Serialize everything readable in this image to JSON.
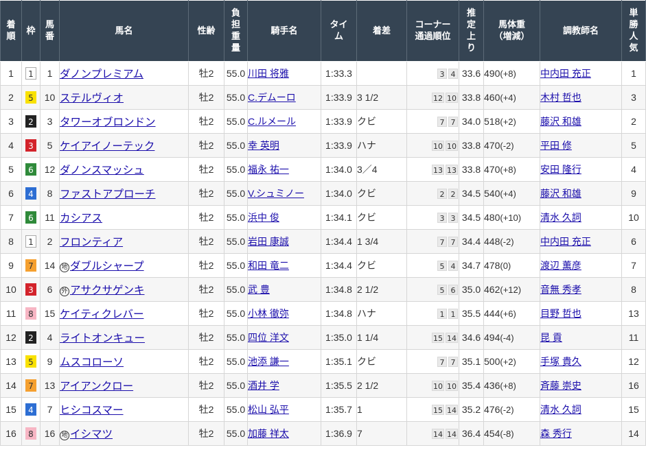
{
  "headers": [
    "着\n順",
    "枠",
    "馬\n番",
    "馬名",
    "性齢",
    "負\n担\n重\n量",
    "騎手名",
    "タイ\nム",
    "着差",
    "コーナー\n通過順位",
    "推\n定\n上\nり",
    "馬体重\n（増減）",
    "調教師名",
    "単\n勝\n人\n気"
  ],
  "waku_colors": {
    "1": {
      "bg": "#ffffff",
      "fg": "#333333",
      "border": "#aaaaaa"
    },
    "2": {
      "bg": "#222222",
      "fg": "#ffffff",
      "border": "#222222"
    },
    "3": {
      "bg": "#d3232b",
      "fg": "#ffffff",
      "border": "#d3232b"
    },
    "4": {
      "bg": "#2d6ed3",
      "fg": "#ffffff",
      "border": "#2d6ed3"
    },
    "5": {
      "bg": "#f9e100",
      "fg": "#333333",
      "border": "#f9e100"
    },
    "6": {
      "bg": "#2f8a3a",
      "fg": "#ffffff",
      "border": "#2f8a3a"
    },
    "7": {
      "bg": "#f5a030",
      "fg": "#333333",
      "border": "#f5a030"
    },
    "8": {
      "bg": "#f7b6c4",
      "fg": "#333333",
      "border": "#f7b6c4"
    }
  },
  "rows": [
    {
      "rank": "1",
      "waku": "1",
      "num": "1",
      "mark": "",
      "name": "ダノンプレミアム",
      "sexage": "牡2",
      "weight": "55.0",
      "jockey": "川田 将雅",
      "time": "1:33.3",
      "margin": "",
      "pass": [
        "3",
        "4"
      ],
      "last3f": "33.6",
      "body": "490",
      "diff": "(+8)",
      "trainer": "中内田 充正",
      "pop": "1"
    },
    {
      "rank": "2",
      "waku": "5",
      "num": "10",
      "mark": "",
      "name": "ステルヴィオ",
      "sexage": "牡2",
      "weight": "55.0",
      "jockey": "C.デムーロ",
      "time": "1:33.9",
      "margin": "3 1/2",
      "pass": [
        "12",
        "10"
      ],
      "last3f": "33.8",
      "body": "460",
      "diff": "(+4)",
      "trainer": "木村 哲也",
      "pop": "3"
    },
    {
      "rank": "3",
      "waku": "2",
      "num": "3",
      "mark": "",
      "name": "タワーオブロンドン",
      "sexage": "牡2",
      "weight": "55.0",
      "jockey": "C.ルメール",
      "time": "1:33.9",
      "margin": "クビ",
      "pass": [
        "7",
        "7"
      ],
      "last3f": "34.0",
      "body": "518",
      "diff": "(+2)",
      "trainer": "藤沢 和雄",
      "pop": "2"
    },
    {
      "rank": "4",
      "waku": "3",
      "num": "5",
      "mark": "",
      "name": "ケイアイノーテック",
      "sexage": "牡2",
      "weight": "55.0",
      "jockey": "幸 英明",
      "time": "1:33.9",
      "margin": "ハナ",
      "pass": [
        "10",
        "10"
      ],
      "last3f": "33.8",
      "body": "470",
      "diff": "(-2)",
      "trainer": "平田 修",
      "pop": "5"
    },
    {
      "rank": "5",
      "waku": "6",
      "num": "12",
      "mark": "",
      "name": "ダノンスマッシュ",
      "sexage": "牡2",
      "weight": "55.0",
      "jockey": "福永 祐一",
      "time": "1:34.0",
      "margin": "3／4",
      "pass": [
        "13",
        "13"
      ],
      "last3f": "33.8",
      "body": "470",
      "diff": "(+8)",
      "trainer": "安田 隆行",
      "pop": "4"
    },
    {
      "rank": "6",
      "waku": "4",
      "num": "8",
      "mark": "",
      "name": "ファストアプローチ",
      "sexage": "牡2",
      "weight": "55.0",
      "jockey": "V.シュミノー",
      "time": "1:34.0",
      "margin": "クビ",
      "pass": [
        "2",
        "2"
      ],
      "last3f": "34.5",
      "body": "540",
      "diff": "(+4)",
      "trainer": "藤沢 和雄",
      "pop": "9"
    },
    {
      "rank": "7",
      "waku": "6",
      "num": "11",
      "mark": "",
      "name": "カシアス",
      "sexage": "牡2",
      "weight": "55.0",
      "jockey": "浜中 俊",
      "time": "1:34.1",
      "margin": "クビ",
      "pass": [
        "3",
        "3"
      ],
      "last3f": "34.5",
      "body": "480",
      "diff": "(+10)",
      "trainer": "清水 久詞",
      "pop": "10"
    },
    {
      "rank": "8",
      "waku": "1",
      "num": "2",
      "mark": "",
      "name": "フロンティア",
      "sexage": "牡2",
      "weight": "55.0",
      "jockey": "岩田 康誠",
      "time": "1:34.4",
      "margin": "1 3/4",
      "pass": [
        "7",
        "7"
      ],
      "last3f": "34.4",
      "body": "448",
      "diff": "(-2)",
      "trainer": "中内田 充正",
      "pop": "6"
    },
    {
      "rank": "9",
      "waku": "7",
      "num": "14",
      "mark": "地",
      "name": "ダブルシャープ",
      "sexage": "牡2",
      "weight": "55.0",
      "jockey": "和田 竜二",
      "time": "1:34.4",
      "margin": "クビ",
      "pass": [
        "5",
        "4"
      ],
      "last3f": "34.7",
      "body": "478",
      "diff": "(0)",
      "trainer": "渡辺 薫彦",
      "pop": "7"
    },
    {
      "rank": "10",
      "waku": "3",
      "num": "6",
      "mark": "外",
      "name": "アサクサゲンキ",
      "sexage": "牡2",
      "weight": "55.0",
      "jockey": "武 豊",
      "time": "1:34.8",
      "margin": "2 1/2",
      "pass": [
        "5",
        "6"
      ],
      "last3f": "35.0",
      "body": "462",
      "diff": "(+12)",
      "trainer": "音無 秀孝",
      "pop": "8"
    },
    {
      "rank": "11",
      "waku": "8",
      "num": "15",
      "mark": "",
      "name": "ケイティクレバー",
      "sexage": "牡2",
      "weight": "55.0",
      "jockey": "小林 徹弥",
      "time": "1:34.8",
      "margin": "ハナ",
      "pass": [
        "1",
        "1"
      ],
      "last3f": "35.5",
      "body": "444",
      "diff": "(+6)",
      "trainer": "目野 哲也",
      "pop": "13"
    },
    {
      "rank": "12",
      "waku": "2",
      "num": "4",
      "mark": "",
      "name": "ライトオンキュー",
      "sexage": "牡2",
      "weight": "55.0",
      "jockey": "四位 洋文",
      "time": "1:35.0",
      "margin": "1 1/4",
      "pass": [
        "15",
        "14"
      ],
      "last3f": "34.6",
      "body": "494",
      "diff": "(-4)",
      "trainer": "昆 貢",
      "pop": "11"
    },
    {
      "rank": "13",
      "waku": "5",
      "num": "9",
      "mark": "",
      "name": "ムスコローソ",
      "sexage": "牡2",
      "weight": "55.0",
      "jockey": "池添 謙一",
      "time": "1:35.1",
      "margin": "クビ",
      "pass": [
        "7",
        "7"
      ],
      "last3f": "35.1",
      "body": "500",
      "diff": "(+2)",
      "trainer": "手塚 貴久",
      "pop": "12"
    },
    {
      "rank": "14",
      "waku": "7",
      "num": "13",
      "mark": "",
      "name": "アイアンクロー",
      "sexage": "牡2",
      "weight": "55.0",
      "jockey": "酒井 学",
      "time": "1:35.5",
      "margin": "2 1/2",
      "pass": [
        "10",
        "10"
      ],
      "last3f": "35.4",
      "body": "436",
      "diff": "(+8)",
      "trainer": "斉藤 崇史",
      "pop": "16"
    },
    {
      "rank": "15",
      "waku": "4",
      "num": "7",
      "mark": "",
      "name": "ヒシコスマー",
      "sexage": "牡2",
      "weight": "55.0",
      "jockey": "松山 弘平",
      "time": "1:35.7",
      "margin": "1",
      "pass": [
        "15",
        "14"
      ],
      "last3f": "35.2",
      "body": "476",
      "diff": "(-2)",
      "trainer": "清水 久詞",
      "pop": "15"
    },
    {
      "rank": "16",
      "waku": "8",
      "num": "16",
      "mark": "地",
      "name": "イシマツ",
      "sexage": "牡2",
      "weight": "55.0",
      "jockey": "加藤 祥太",
      "time": "1:36.9",
      "margin": "7",
      "pass": [
        "14",
        "14"
      ],
      "last3f": "36.4",
      "body": "454",
      "diff": "(-8)",
      "trainer": "森 秀行",
      "pop": "14"
    }
  ]
}
